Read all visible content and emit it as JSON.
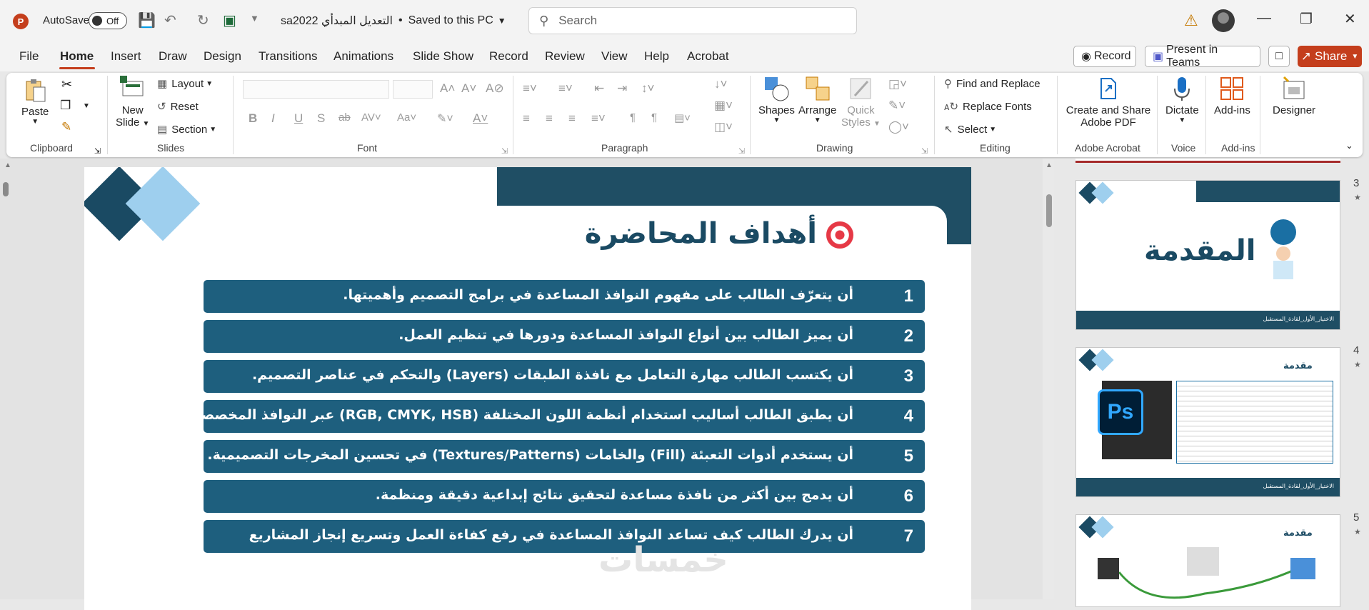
{
  "titlebar": {
    "app_logo": "P",
    "autosave_label": "AutoSave",
    "autosave_state": "Off",
    "doc_title": "sa2022 التعديل المبدأي",
    "save_status": "Saved to this PC",
    "search_placeholder": "Search"
  },
  "menu": {
    "tabs": [
      "File",
      "Home",
      "Insert",
      "Draw",
      "Design",
      "Transitions",
      "Animations",
      "Slide Show",
      "Record",
      "Review",
      "View",
      "Help",
      "Acrobat"
    ],
    "active_tab": "Home",
    "record_label": "Record",
    "present_teams_label": "Present in Teams",
    "share_label": "Share"
  },
  "ribbon": {
    "clipboard": {
      "paste": "Paste",
      "label": "Clipboard"
    },
    "slides": {
      "new_slide": "New",
      "new_slide2": "Slide",
      "layout": "Layout",
      "reset": "Reset",
      "section": "Section",
      "label": "Slides"
    },
    "font": {
      "label": "Font"
    },
    "paragraph": {
      "label": "Paragraph"
    },
    "drawing": {
      "shapes": "Shapes",
      "arrange": "Arrange",
      "quick_styles": "Quick",
      "quick_styles2": "Styles",
      "label": "Drawing"
    },
    "editing": {
      "find_replace": "Find and Replace",
      "replace_fonts": "Replace Fonts",
      "select": "Select",
      "label": "Editing"
    },
    "acrobat": {
      "create_share": "Create and Share",
      "create_share2": "Adobe PDF",
      "label": "Adobe Acrobat"
    },
    "voice": {
      "dictate": "Dictate",
      "label": "Voice"
    },
    "addins": {
      "addins": "Add-ins",
      "label": "Add-ins"
    },
    "designer": {
      "designer": "Designer"
    }
  },
  "slide": {
    "title": "أهداف المحاضرة",
    "objectives": [
      {
        "num": "1",
        "text": "أن يتعرّف الطالب على مفهوم النوافذ المساعدة في برامج التصميم وأهميتها."
      },
      {
        "num": "2",
        "text": "أن يميز الطالب بين أنواع النوافذ المساعدة ودورها في تنظيم العمل."
      },
      {
        "num": "3",
        "text": "أن يكتسب الطالب مهارة التعامل مع نافذة الطبقات (Layers) والتحكم في عناصر التصميم."
      },
      {
        "num": "4",
        "text": "أن يطبق الطالب أساليب استخدام أنظمة اللون المختلفة (RGB, CMYK, HSB) عبر النوافذ المخصصة لها."
      },
      {
        "num": "5",
        "text": "أن يستخدم أدوات التعبئة (Fill) والخامات (Textures/Patterns) في تحسين المخرجات التصميمية."
      },
      {
        "num": "6",
        "text": "أن يدمج بين أكثر من نافذة مساعدة لتحقيق نتائج إبداعية دقيقة ومنظمة."
      },
      {
        "num": "7",
        "text": "أن يدرك الطالب كيف تساعد النوافذ المساعدة في رفع كفاءة العمل وتسريع إنجاز المشاريع"
      }
    ],
    "watermark": "خمسات"
  },
  "thumbnails": [
    {
      "num": "3",
      "title": "المقدمة",
      "footer": "الاختيار_الأول_لقادة_المستقبل"
    },
    {
      "num": "4",
      "title": "مقدمة",
      "footer": "الاختيار_الأول_لقادة_المستقبل",
      "badge": "Ps"
    },
    {
      "num": "5",
      "title": "مقدمة"
    }
  ],
  "colors": {
    "accent": "#c43e1c",
    "slide_dark": "#1f4e64",
    "slide_bar": "#1e5f7e",
    "slide_light": "#9ecfee"
  }
}
